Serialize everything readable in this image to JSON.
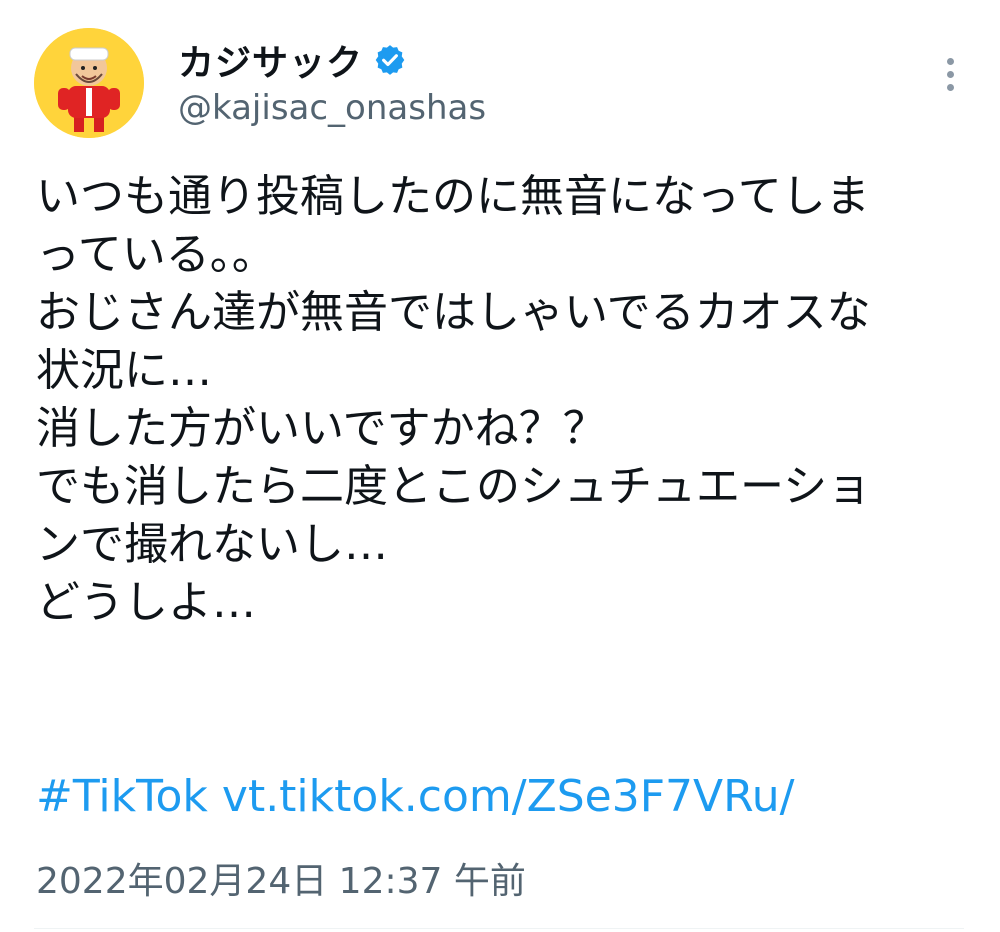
{
  "tweet": {
    "author": {
      "display_name": "カジサック",
      "handle": "@kajisac_onashas",
      "verified": true,
      "avatar_icon": "cartoon-avatar-icon",
      "verified_icon": "verified-badge-icon"
    },
    "more_icon": "more-options-icon",
    "text": "いつも通り投稿したのに無音になってしま\nっている。。\nおじさん達が無音ではしゃいでるカオスな\n状況に…\n消した方がいいですかね？？\nでも消したら二度とこのシュチュエーショ\nンで撮れないし…\nどうしよ…",
    "hashtag": "#TikTok",
    "link": "vt.tiktok.com/ZSe3F7VRu/",
    "timestamp": "2022年02月24日 12:37 午前"
  },
  "colors": {
    "link": "#1d9bf0",
    "secondary_text": "#536471",
    "primary_text": "#0f1419",
    "verified": "#1d9bf0",
    "avatar_bg": "#ffd43b"
  }
}
